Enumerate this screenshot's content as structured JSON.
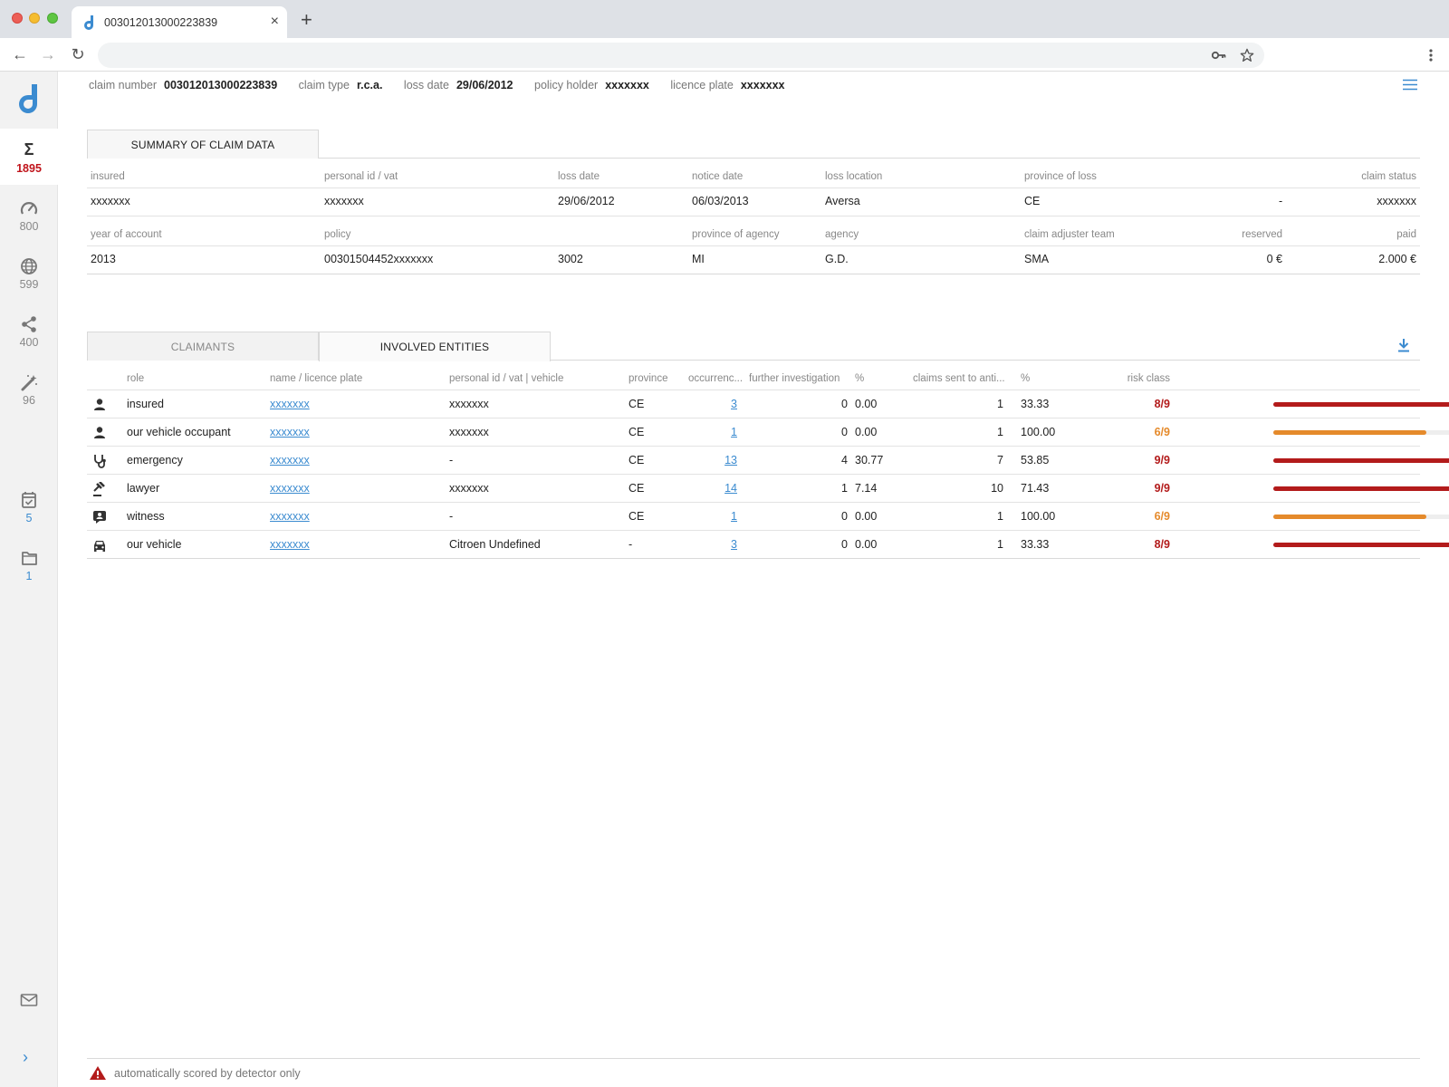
{
  "browser": {
    "tab_title": "003012013000223839",
    "address_value": "",
    "icons": [
      "back-icon",
      "forward-icon",
      "reload-icon",
      "key-icon",
      "star-icon",
      "kebab-icon"
    ]
  },
  "sidebar": {
    "items": [
      {
        "icon": "sigma-icon",
        "count": "1895"
      },
      {
        "icon": "speedometer-icon",
        "count": "800"
      },
      {
        "icon": "globe-icon",
        "count": "599"
      },
      {
        "icon": "share-icon",
        "count": "400"
      },
      {
        "icon": "magic-wand-icon",
        "count": "96"
      },
      {
        "icon": "calendar-check-icon",
        "count": "5"
      },
      {
        "icon": "folder-icon",
        "count": "1"
      }
    ]
  },
  "header": {
    "claim_number_label": "claim number",
    "claim_number": "003012013000223839",
    "claim_type_label": "claim type",
    "claim_type": "r.c.a.",
    "loss_date_label": "loss date",
    "loss_date": "29/06/2012",
    "policy_holder_label": "policy holder",
    "policy_holder": "xxxxxxx",
    "licence_plate_label": "licence plate",
    "licence_plate": "xxxxxxx"
  },
  "summary": {
    "tab_label": "SUMMARY OF CLAIM DATA",
    "row1": {
      "labels": {
        "insured": "insured",
        "personal_id": "personal id / vat",
        "loss_date": "loss date",
        "notice_date": "notice date",
        "loss_location": "loss location",
        "province_of_loss": "province of loss",
        "claim_status": "claim status"
      },
      "values": {
        "insured": "xxxxxxx",
        "personal_id": "xxxxxxx",
        "loss_date": "29/06/2012",
        "notice_date": "06/03/2013",
        "loss_location": "Aversa",
        "province_of_loss": "CE",
        "dash": "-",
        "claim_status": "xxxxxxx"
      }
    },
    "row2": {
      "labels": {
        "year_of_account": "year of account",
        "policy": "policy",
        "province_of_agency": "province of agency",
        "agency": "agency",
        "adjuster_team": "claim adjuster team",
        "reserved": "reserved",
        "paid": "paid"
      },
      "values": {
        "year_of_account": "2013",
        "policy": "00301504452xxxxxxx",
        "agency_code": "3002",
        "province_of_agency": "MI",
        "agency": "G.D.",
        "adjuster_team": "SMA",
        "reserved": "0 €",
        "paid": "2.000 €"
      }
    }
  },
  "entities": {
    "tabs": [
      "CLAIMANTS",
      "INVOLVED ENTITIES"
    ],
    "active_tab": 1,
    "columns": [
      "role",
      "name / licence plate",
      "personal id / vat | vehicle",
      "province",
      "occurrenc...",
      "further investigation",
      "%",
      "claims sent to anti...",
      "%",
      "risk class"
    ],
    "rows": [
      {
        "icon": "person-icon",
        "role": "insured",
        "name": "xxxxxxx",
        "personal_id": "xxxxxxx",
        "province": "CE",
        "occurrences": "3",
        "further": "0",
        "further_pct": "0.00",
        "sent": "1",
        "sent_pct": "33.33",
        "risk": "8/9",
        "risk_value": 8,
        "risk_color": "#b31b1b"
      },
      {
        "icon": "person-icon",
        "role": "our vehicle occupant",
        "name": "xxxxxxx",
        "personal_id": "xxxxxxx",
        "province": "CE",
        "occurrences": "1",
        "further": "0",
        "further_pct": "0.00",
        "sent": "1",
        "sent_pct": "100.00",
        "risk": "6/9",
        "risk_value": 6,
        "risk_color": "#e58a2b"
      },
      {
        "icon": "stethoscope-icon",
        "role": "emergency",
        "name": "xxxxxxx",
        "personal_id": "-",
        "province": "CE",
        "occurrences": "13",
        "further": "4",
        "further_pct": "30.77",
        "sent": "7",
        "sent_pct": "53.85",
        "risk": "9/9",
        "risk_value": 9,
        "risk_color": "#b31b1b"
      },
      {
        "icon": "gavel-icon",
        "role": "lawyer",
        "name": "xxxxxxx",
        "personal_id": "xxxxxxx",
        "province": "CE",
        "occurrences": "14",
        "further": "1",
        "further_pct": "7.14",
        "sent": "10",
        "sent_pct": "71.43",
        "risk": "9/9",
        "risk_value": 9,
        "risk_color": "#b31b1b"
      },
      {
        "icon": "witness-icon",
        "role": "witness",
        "name": "xxxxxxx",
        "personal_id": "-",
        "province": "CE",
        "occurrences": "1",
        "further": "0",
        "further_pct": "0.00",
        "sent": "1",
        "sent_pct": "100.00",
        "risk": "6/9",
        "risk_value": 6,
        "risk_color": "#e58a2b"
      },
      {
        "icon": "car-icon",
        "role": "our vehicle",
        "name": "xxxxxxx",
        "personal_id": "Citroen Undefined",
        "province": "-",
        "occurrences": "3",
        "further": "0",
        "further_pct": "0.00",
        "sent": "1",
        "sent_pct": "33.33",
        "risk": "8/9",
        "risk_value": 8,
        "risk_color": "#b31b1b"
      }
    ]
  },
  "footer": {
    "note": "automatically scored by detector only",
    "icon": "warning-icon"
  },
  "colors": {
    "accent": "#3b8bd0",
    "alert": "#c0141b",
    "risk_high": "#b31b1b",
    "risk_mid": "#e58a2b"
  }
}
